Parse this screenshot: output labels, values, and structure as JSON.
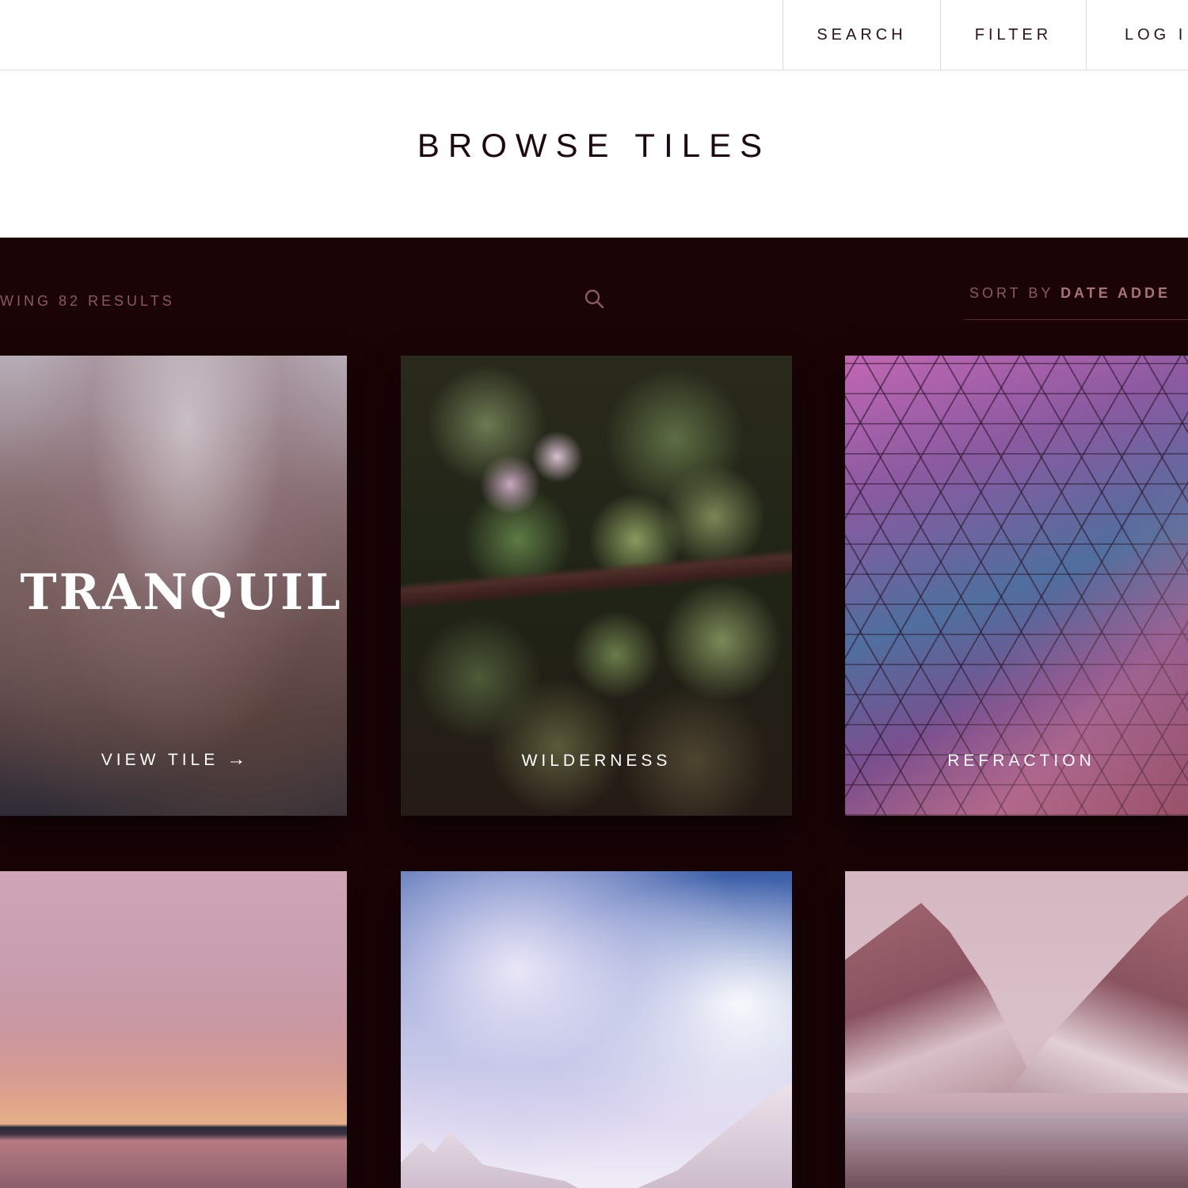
{
  "nav": {
    "search_label": "SEARCH",
    "filter_label": "FILTER",
    "login_label": "LOG I"
  },
  "page": {
    "title": "BROWSE TILES"
  },
  "toolbar": {
    "results_text": "WING 82 RESULTS",
    "search_icon": "search-icon",
    "sort_prefix": "SORT BY",
    "sort_value": "DATE ADDE"
  },
  "tiles": [
    {
      "brand": "TRANQUIL",
      "label": "VIEW TILE",
      "arrow": "→"
    },
    {
      "label": "WILDERNESS"
    },
    {
      "label": "REFRACTION"
    },
    {
      "label": ""
    },
    {
      "label": ""
    },
    {
      "label": ""
    }
  ],
  "colors": {
    "gallery_background": "#1a0406",
    "muted_text": "#8a5a60",
    "title_text": "#1d0a0e"
  }
}
